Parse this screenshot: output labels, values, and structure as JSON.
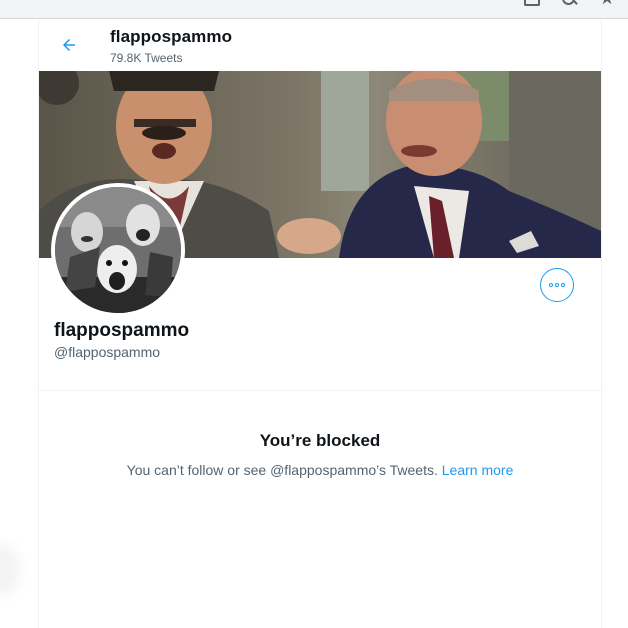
{
  "profile": {
    "display_name": "flappospammo",
    "tweet_count": "79.8K Tweets",
    "handle": "@flappospammo"
  },
  "blocked": {
    "title": "You’re blocked",
    "message": "You can’t follow or see @flappospammo’s Tweets.",
    "learn_more": "Learn more"
  },
  "icons": {
    "back": "arrow-left-icon",
    "more": "more-horizontal-icon",
    "browser": [
      "tab-icon",
      "search-icon",
      "star-icon"
    ]
  },
  "colors": {
    "accent": "#1d9bf0",
    "text_primary": "#0f1419",
    "text_secondary": "#536471",
    "border": "#eff3f4"
  }
}
